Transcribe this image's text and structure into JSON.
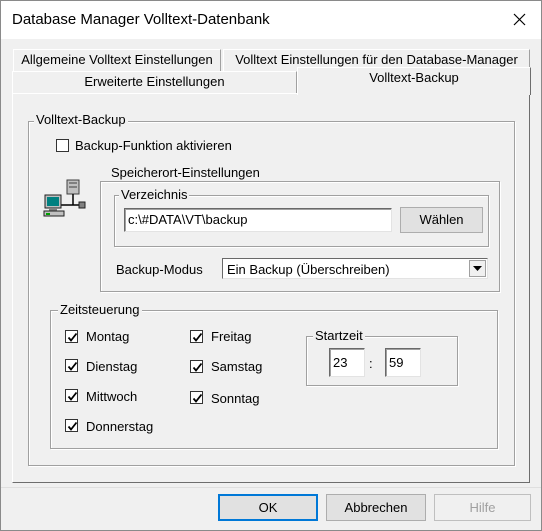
{
  "window": {
    "title": "Database Manager Volltext-Datenbank"
  },
  "tabs": {
    "row1": [
      "Allgemeine Volltext Einstellungen",
      "Volltext Einstellungen für den Database-Manager"
    ],
    "row2": [
      "Erweiterte Einstellungen",
      "Volltext-Backup"
    ],
    "active": "Volltext-Backup"
  },
  "backup": {
    "group_label": "Volltext-Backup",
    "enable_label": "Backup-Funktion aktivieren",
    "enable_checked": false,
    "icon": "network-computer-icon",
    "storage": {
      "group_label": "Speicherort-Einstellungen",
      "directory": {
        "group_label": "Verzeichnis",
        "value": "c:\\#DATA\\VT\\backup",
        "browse_label": "Wählen"
      },
      "mode_label": "Backup-Modus",
      "mode_value": "Ein Backup (Überschreiben)"
    }
  },
  "schedule": {
    "group_label": "Zeitsteuerung",
    "days": [
      {
        "label": "Montag",
        "checked": true
      },
      {
        "label": "Dienstag",
        "checked": true
      },
      {
        "label": "Mittwoch",
        "checked": true
      },
      {
        "label": "Donnerstag",
        "checked": true
      },
      {
        "label": "Freitag",
        "checked": true
      },
      {
        "label": "Samstag",
        "checked": true
      },
      {
        "label": "Sonntag",
        "checked": true
      }
    ],
    "start_time": {
      "group_label": "Startzeit",
      "hour": "23",
      "separator": ":",
      "minute": "59"
    }
  },
  "buttons": {
    "ok": "OK",
    "cancel": "Abbrechen",
    "help": "Hilfe"
  }
}
